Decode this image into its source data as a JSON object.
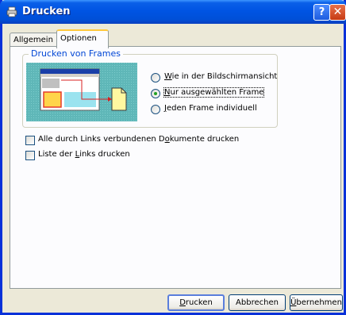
{
  "window": {
    "title": "Drucken",
    "help_glyph": "?",
    "close_glyph": "✕",
    "title_icon": "printer-icon"
  },
  "tabs": [
    {
      "label": "Allgemein",
      "selected": false
    },
    {
      "label": "Optionen",
      "selected": true
    }
  ],
  "frames_group": {
    "label": "Drucken von Frames",
    "options": [
      {
        "prefix": "",
        "accel": "W",
        "rest": "ie in der Bildschirmansicht",
        "checked": false
      },
      {
        "prefix": "",
        "accel": "N",
        "rest": "ur ausgewählten Frame",
        "checked": true
      },
      {
        "prefix": "",
        "accel": "J",
        "rest": "eden Frame individuell",
        "checked": false
      }
    ]
  },
  "checkboxes": [
    {
      "prefix": "Alle durch Links verbundenen D",
      "accel": "o",
      "rest": "kumente drucken",
      "checked": false
    },
    {
      "prefix": "Liste der ",
      "accel": "L",
      "rest": "inks drucken",
      "checked": false
    }
  ],
  "buttons": {
    "print": {
      "prefix": "",
      "accel": "D",
      "rest": "rucken"
    },
    "cancel": {
      "label": "Abbrechen"
    },
    "apply": {
      "prefix": "",
      "accel": "Ü",
      "rest": "bernehmen"
    }
  },
  "colors": {
    "titlebar": "#0054e3",
    "dialog_bg": "#ece9d8",
    "group_label": "#0046d5",
    "radio_dot": "#21a121",
    "preview_bg": "#5fb7b8"
  }
}
